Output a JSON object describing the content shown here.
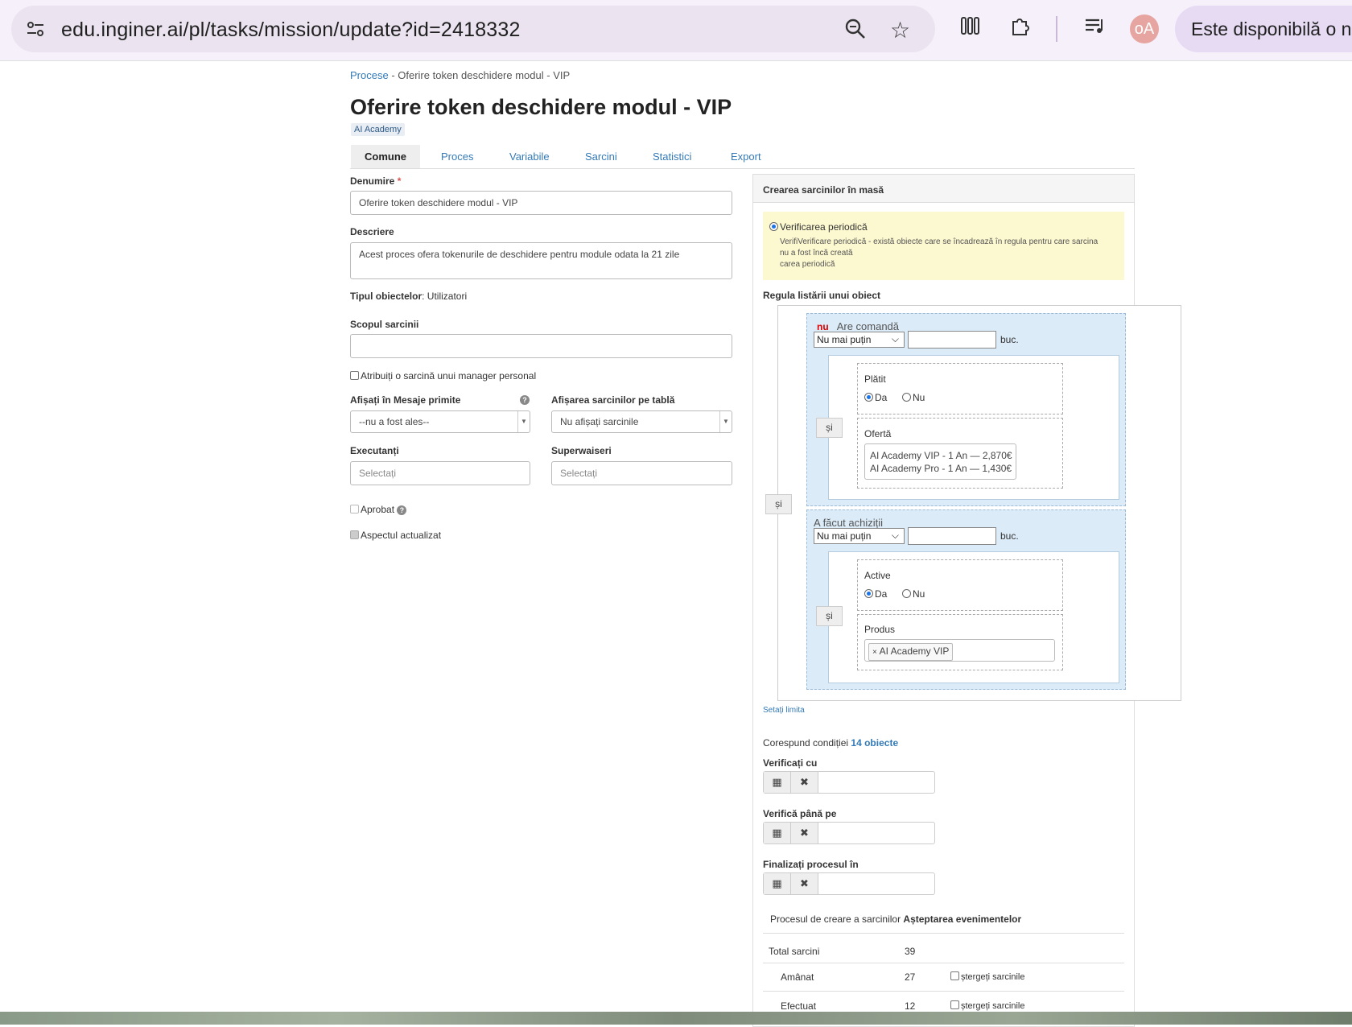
{
  "browser": {
    "url": "edu.inginer.ai/pl/tasks/mission/update?id=2418332",
    "avatar_text": "oA",
    "notice": "Este disponibilă o n"
  },
  "breadcrumb": {
    "parent": "Procese",
    "sep": " - ",
    "current": "Oferire token deschidere modul - VIP"
  },
  "page_title": "Oferire token deschidere modul - VIP",
  "tag": "AI Academy",
  "tabs": [
    "Comune",
    "Proces",
    "Variabile",
    "Sarcini",
    "Statistici",
    "Export"
  ],
  "form": {
    "name_label": "Denumire",
    "name_value": "Oferire token deschidere modul - VIP",
    "desc_label": "Descriere",
    "desc_value": "Acest proces ofera tokenurile de deschidere pentru module odata la 21 zile",
    "type_label": "Tipul obiectelor",
    "type_value": ": Utilizatori",
    "scope_label": "Scopul sarcinii",
    "scope_value": "",
    "assign_manager": "Atribuiți o sarcină unui manager personal",
    "inbox_label": "Afișați în Mesaje primite",
    "inbox_value": "--nu a fost ales--",
    "board_label": "Afișarea sarcinilor pe tablă",
    "board_value": "Nu afișați sarcinile",
    "executors_label": "Executanți",
    "executors_placeholder": "Selectați",
    "supervisors_label": "Superwaiseri",
    "supervisors_placeholder": "Selectați",
    "approved": "Aprobat",
    "updated": "Aspectul actualizat"
  },
  "panel": {
    "title": "Crearea sarcinilor în masă",
    "periodic_label": "Verificarea periodică",
    "periodic_desc_1": "VerifiVerificare periodică - există obiecte care se încadrează în regula pentru care sarcina",
    "periodic_desc_2": "nu a fost încă creată",
    "periodic_desc_3": "carea periodică",
    "rule_label": "Regula listării unui obiect",
    "and_label": "și",
    "cond1": {
      "neg": "nu",
      "title": "Are comandă",
      "op": "Nu mai puțin",
      "unit": "buc.",
      "paid_label": "Plătit",
      "yes": "Da",
      "no": "Nu",
      "offer_label": "Ofertă",
      "offers": [
        "AI Academy VIP - 1 An — 2,870€",
        "AI Academy Pro - 1 An — 1,430€"
      ]
    },
    "cond2": {
      "title": "A făcut achiziții",
      "op": "Nu mai puțin",
      "unit": "buc.",
      "active_label": "Active",
      "yes": "Da",
      "no": "Nu",
      "product_label": "Produs",
      "product_chip": "AI Academy VIP"
    },
    "set_limit": "Setați limita",
    "match_text": "Corespund condiției",
    "match_count": "14 obiecte",
    "check_from": "Verificați cu",
    "check_until": "Verifică până pe",
    "finish_in": "Finalizați procesul în",
    "process_text": "Procesul de creare a sarcinilor",
    "process_state": "Așteptarea evenimentelor",
    "stats": [
      {
        "label": "Total sarcini",
        "value": "39",
        "action": ""
      },
      {
        "label": "Amânat",
        "value": "27",
        "action": "ștergeți sarcinile"
      },
      {
        "label": "Efectuat",
        "value": "12",
        "action": "ștergeți sarcinile"
      }
    ]
  }
}
